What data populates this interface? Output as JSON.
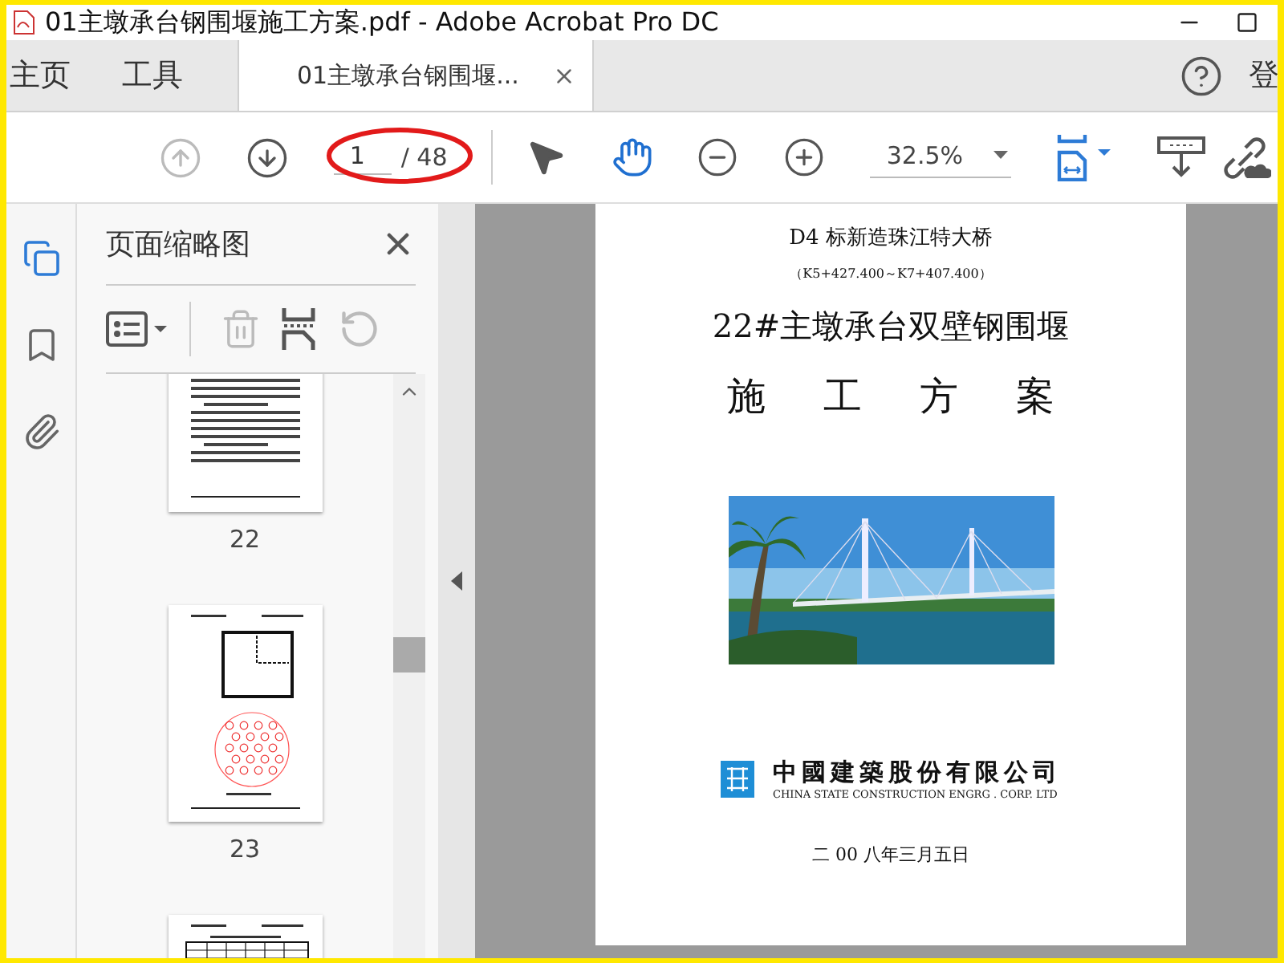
{
  "window": {
    "title": "01主墩承台钢围堰施工方案.pdf - Adobe Acrobat Pro DC"
  },
  "tabs": [
    {
      "label": "主页",
      "kind": "nav",
      "selected": false
    },
    {
      "label": "工具",
      "kind": "nav",
      "selected": false
    },
    {
      "label": "01主墩承台钢围堰...",
      "kind": "document",
      "selected": true
    }
  ],
  "account_label": "登",
  "toolbar": {
    "tools": [
      {
        "kind": "previous",
        "disabled": true
      },
      {
        "kind": "next",
        "disabled": false
      }
    ],
    "page_number": "1",
    "page_total": "/ 48",
    "page_field_circled": true,
    "pointers": [
      {
        "kind": "select",
        "selected": false
      },
      {
        "kind": "hand",
        "selected": true
      }
    ],
    "zoom": "32.5%"
  },
  "side_rail": [
    {
      "kind": "pages",
      "selected": true
    },
    {
      "kind": "bookmarks",
      "selected": false
    },
    {
      "kind": "attachments",
      "selected": false
    }
  ],
  "thumbnail_panel": {
    "title": "页面缩略图",
    "tools": [
      {
        "kind": "options",
        "disabled": false
      },
      {
        "kind": "delete",
        "disabled": true
      },
      {
        "kind": "insert",
        "disabled": false
      },
      {
        "kind": "rotate",
        "disabled": true
      }
    ],
    "thumbnails": [
      {
        "kind": "text",
        "label": "22"
      },
      {
        "kind": "diagram",
        "label": "23"
      },
      {
        "kind": "table"
      }
    ]
  },
  "document": {
    "lines": [
      {
        "kind": "subtitle",
        "text": "D4 标新造珠江特大桥"
      },
      {
        "kind": "small",
        "text": "（K5+427.400～K7+407.400）"
      },
      {
        "kind": "title",
        "text": "22#主墩承台双壁钢围堰"
      },
      {
        "kind": "spaced",
        "text": "施工方案"
      }
    ],
    "company": {
      "name": "中國建築股份有限公司",
      "english": "CHINA STATE CONSTRUCTION ENGRG . CORP. LTD"
    },
    "date": "二 00 八年三月五日"
  }
}
